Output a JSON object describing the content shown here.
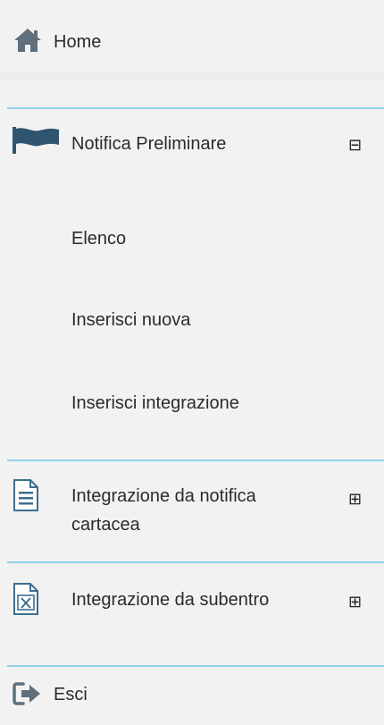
{
  "menu": {
    "home": {
      "label": "Home",
      "icon": "home-icon"
    },
    "notifica": {
      "label": "Notifica Preliminare",
      "icon": "flag-icon",
      "toggle": "⊟",
      "subitems": [
        {
          "label": "Elenco"
        },
        {
          "label": "Inserisci nuova"
        },
        {
          "label": "Inserisci integrazione"
        }
      ]
    },
    "integrazione_cartacea": {
      "label_line1": "Integrazione da notifica",
      "label_line2": "cartacea",
      "icon": "document-icon",
      "toggle": "⊞"
    },
    "integrazione_subentro": {
      "label": "Integrazione da subentro",
      "icon": "excel-file-icon",
      "toggle": "⊞"
    },
    "esci": {
      "label": "Esci",
      "icon": "sign-out-icon"
    }
  },
  "colors": {
    "background": "#f2f2f2",
    "divider": "#8fd1f0",
    "icon_gray": "#5f6f7c",
    "icon_blue": "#3c6e8f"
  }
}
